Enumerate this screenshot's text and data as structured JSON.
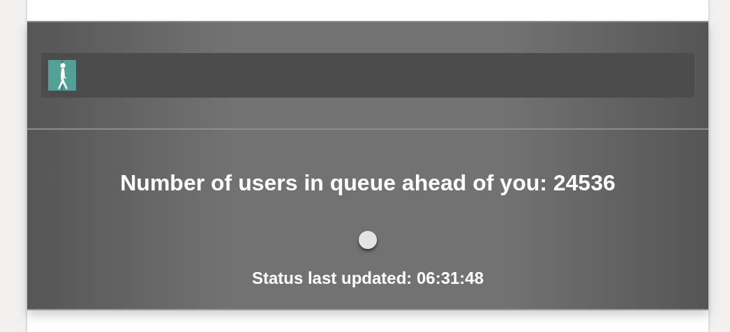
{
  "queue": {
    "message": "Number of users in queue ahead of you: 24536",
    "status": "Status last updated: 06:31:48"
  }
}
